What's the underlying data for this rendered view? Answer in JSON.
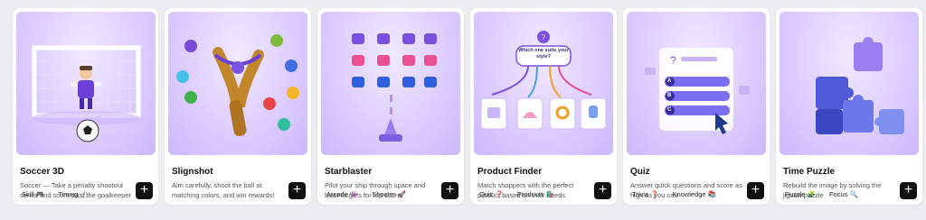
{
  "cards": [
    {
      "title": "Soccer 3D",
      "description": "Soccer — Take a penalty shootout series and score past the goalkeeper",
      "tags": [
        "Skill 🎮",
        "Timing ⏱️"
      ],
      "add_label": "+"
    },
    {
      "title": "Slignshot",
      "description": "Aim carefully, shoot the ball at matching colors, and win rewards!",
      "tags": [],
      "add_label": "+"
    },
    {
      "title": "Starblaster",
      "description": "Pilot your ship through space and blast targets for top score",
      "tags": [
        "Arcade 👾",
        "Shooter 🚀"
      ],
      "add_label": "+"
    },
    {
      "title": "Product Finder",
      "description": "Match shoppers with the perfect product based on their needs",
      "tags": [
        "Quiz ❓",
        "Products 🛍️"
      ],
      "add_label": "+",
      "bubble": "Which one suits your style?"
    },
    {
      "title": "Quiz",
      "description": "Answer quick questions and score as high as you can",
      "tags": [
        "Trivia ❓",
        "Knowledge 📚"
      ],
      "add_label": "+",
      "options": [
        "A",
        "B",
        "C"
      ]
    },
    {
      "title": "Time Puzzle",
      "description": "Rebuild the image by solving the jigsaw puzzle",
      "tags": [
        "Puzzle 🧩",
        "Focus 🔍"
      ],
      "add_label": "+"
    }
  ]
}
